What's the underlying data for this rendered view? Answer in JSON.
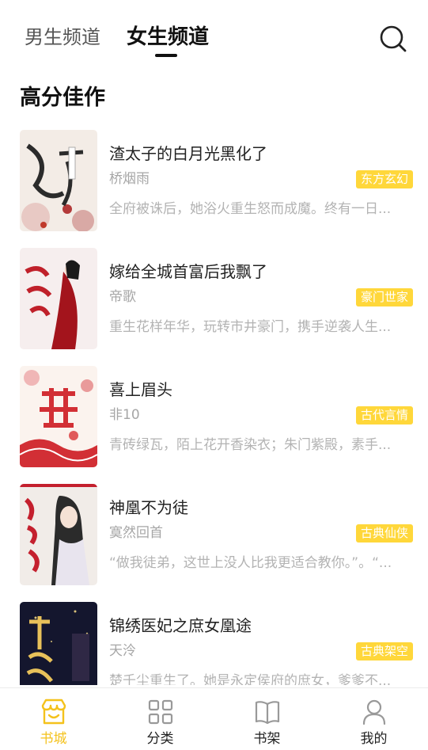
{
  "header": {
    "tabs": [
      {
        "label": "男生频道",
        "active": false
      },
      {
        "label": "女生频道",
        "active": true
      }
    ]
  },
  "section": {
    "title": "高分佳作"
  },
  "books": [
    {
      "title": "渣太子的白月光黑化了",
      "author": "桥烟雨",
      "tag": "东方玄幻",
      "desc": "全府被诛后，她浴火重生怒而成魔。终有一日..."
    },
    {
      "title": "嫁给全城首富后我飘了",
      "author": "帝歌",
      "tag": "豪门世家",
      "desc": "重生花样年华，玩转市井豪门，携手逆袭人生..."
    },
    {
      "title": "喜上眉头",
      "author": "非10",
      "tag": "古代言情",
      "desc": "青砖绿瓦，陌上花开香染衣；朱门紫殿，素手..."
    },
    {
      "title": "神凰不为徒",
      "author": "寞然回首",
      "tag": "古典仙侠",
      "desc": "“做我徒弟，这世上没人比我更适合教你。”。“..."
    },
    {
      "title": "锦绣医妃之庶女凰途",
      "author": "天泠",
      "tag": "古典架空",
      "desc": "楚千尘重生了。她是永定侯府的庶女，爹爹不..."
    }
  ],
  "nav": {
    "items": [
      {
        "label": "书城",
        "icon": "store-icon",
        "active": true
      },
      {
        "label": "分类",
        "icon": "grid-icon",
        "active": false
      },
      {
        "label": "书架",
        "icon": "book-icon",
        "active": false
      },
      {
        "label": "我的",
        "icon": "user-icon",
        "active": false
      }
    ]
  },
  "colors": {
    "accent": "#ffd73a",
    "active_nav": "#f4c21c",
    "muted_text": "#a6a6a6"
  }
}
